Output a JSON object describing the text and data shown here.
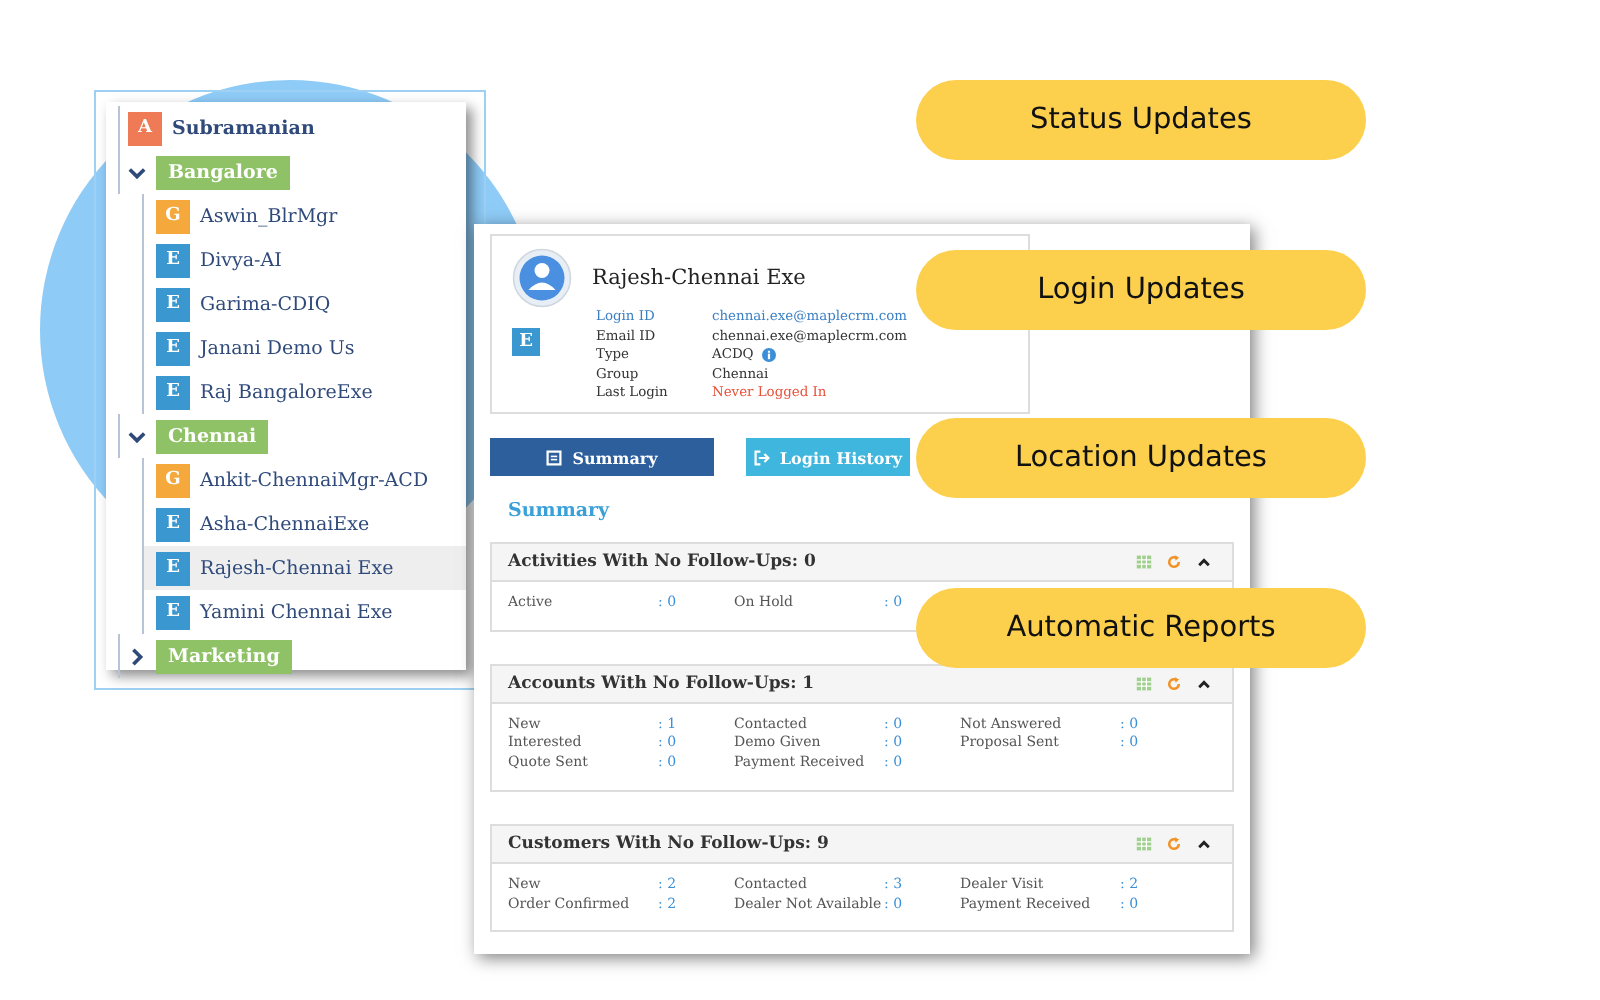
{
  "tree": {
    "root": {
      "badge": "A",
      "color": "#ee7b55",
      "name": "Subramanian"
    },
    "groups": [
      {
        "name": "Bangalore",
        "expanded": true,
        "children": [
          {
            "badge": "G",
            "color": "#f5a93d",
            "name": "Aswin_BlrMgr",
            "selected": false
          },
          {
            "badge": "E",
            "color": "#3a97cf",
            "name": "Divya-AI",
            "selected": false
          },
          {
            "badge": "E",
            "color": "#3a97cf",
            "name": "Garima-CDIQ",
            "selected": false
          },
          {
            "badge": "E",
            "color": "#3a97cf",
            "name": "Janani Demo Us",
            "selected": false
          },
          {
            "badge": "E",
            "color": "#3a97cf",
            "name": "Raj BangaloreExe",
            "selected": false
          }
        ]
      },
      {
        "name": "Chennai",
        "expanded": true,
        "children": [
          {
            "badge": "G",
            "color": "#f5a93d",
            "name": "Ankit-ChennaiMgr-ACD",
            "selected": false
          },
          {
            "badge": "E",
            "color": "#3a97cf",
            "name": "Asha-ChennaiExe",
            "selected": false
          },
          {
            "badge": "E",
            "color": "#3a97cf",
            "name": "Rajesh-Chennai Exe",
            "selected": true
          },
          {
            "badge": "E",
            "color": "#3a97cf",
            "name": "Yamini Chennai Exe",
            "selected": false
          }
        ]
      },
      {
        "name": "Marketing",
        "expanded": false
      }
    ]
  },
  "profile": {
    "name": "Rajesh-Chennai Exe",
    "badge": "E",
    "fields": [
      {
        "label": "Login ID",
        "value": "chennai.exe@maplecrm.com",
        "kind": "link"
      },
      {
        "label": "Email ID",
        "value": "chennai.exe@maplecrm.com",
        "kind": "plain"
      },
      {
        "label": "Type",
        "value": "ACDQ",
        "kind": "info"
      },
      {
        "label": "Group",
        "value": "Chennai",
        "kind": "plain"
      },
      {
        "label": "Last Login",
        "value": "Never Logged In",
        "kind": "alert"
      }
    ]
  },
  "buttons": [
    {
      "label": "Summary",
      "selected": true
    },
    {
      "label": "Login History",
      "selected": false
    }
  ],
  "section_title": "Summary",
  "cards": [
    {
      "title": "Activities With No Follow-Ups: 0",
      "items": [
        {
          "label": "Active",
          "value": ": 0"
        },
        {
          "label": "On Hold",
          "value": ": 0"
        }
      ]
    },
    {
      "title": "Accounts With No Follow-Ups: 1",
      "items": [
        {
          "label": "New",
          "value": ": 1"
        },
        {
          "label": "Contacted",
          "value": ": 0"
        },
        {
          "label": "Not Answered",
          "value": ": 0"
        },
        {
          "label": "Interested",
          "value": ": 0"
        },
        {
          "label": "Demo Given",
          "value": ": 0"
        },
        {
          "label": "Proposal Sent",
          "value": ": 0"
        },
        {
          "label": "Quote Sent",
          "value": ": 0"
        },
        {
          "label": "Payment Received",
          "value": ": 0"
        }
      ]
    },
    {
      "title": "Customers With No Follow-Ups: 9",
      "items": [
        {
          "label": "New",
          "value": ": 2"
        },
        {
          "label": "Contacted",
          "value": ": 3"
        },
        {
          "label": "Dealer Visit",
          "value": ": 2"
        },
        {
          "label": "Order Confirmed",
          "value": ": 2"
        },
        {
          "label": "Dealer Not Available",
          "value": ": 0"
        },
        {
          "label": "Payment Received",
          "value": ": 0"
        }
      ]
    }
  ],
  "features": [
    "Status Updates",
    "Login Updates",
    "Location Updates",
    "Automatic Reports"
  ]
}
